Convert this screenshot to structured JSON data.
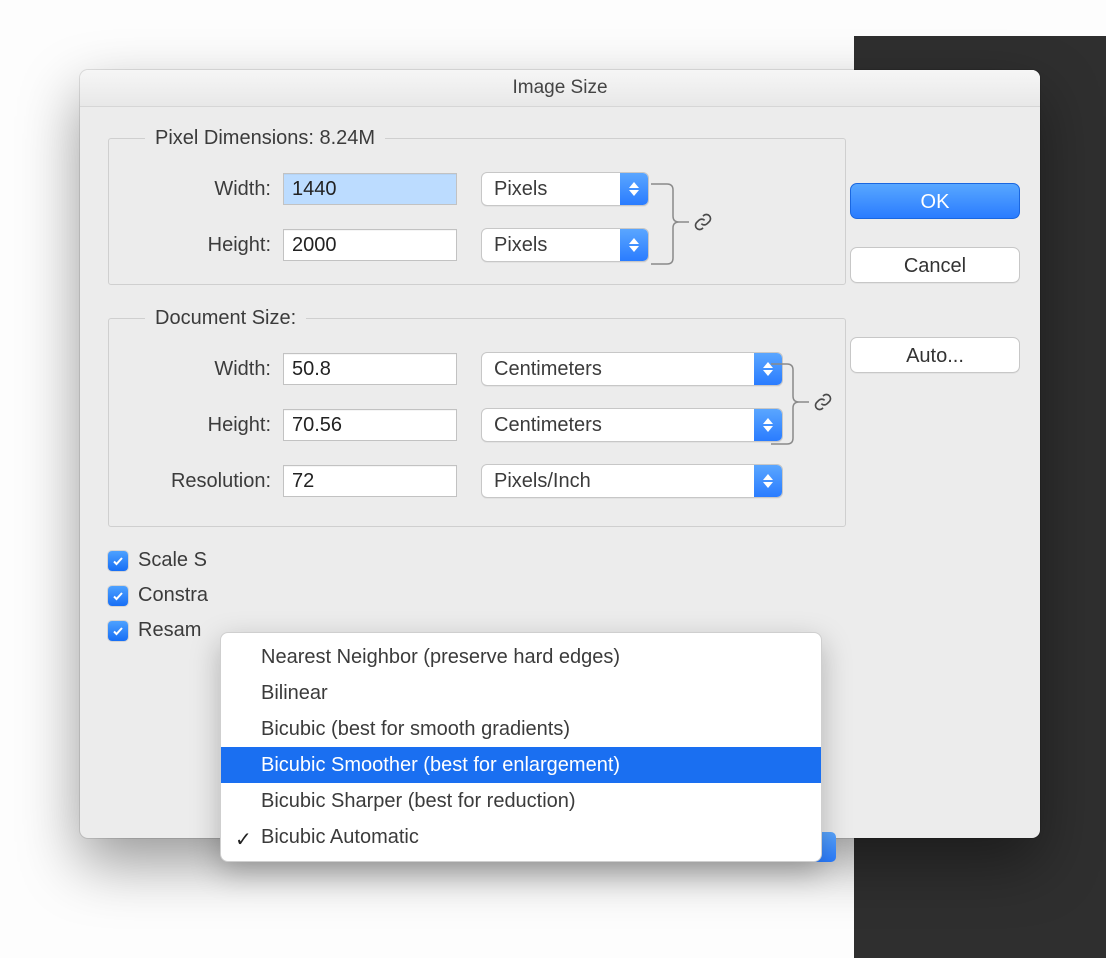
{
  "dialog_title": "Image Size",
  "pixel_dimensions": {
    "legend": "Pixel Dimensions:  8.24M",
    "width_label": "Width:",
    "width_value": "1440",
    "width_unit": "Pixels",
    "height_label": "Height:",
    "height_value": "2000",
    "height_unit": "Pixels"
  },
  "document_size": {
    "legend": "Document Size:",
    "width_label": "Width:",
    "width_value": "50.8",
    "width_unit": "Centimeters",
    "height_label": "Height:",
    "height_value": "70.56",
    "height_unit": "Centimeters",
    "resolution_label": "Resolution:",
    "resolution_value": "72",
    "resolution_unit": "Pixels/Inch"
  },
  "checkboxes": {
    "scale": {
      "label_visible": "Scale S",
      "checked": true
    },
    "constrain": {
      "label_visible": "Constra",
      "checked": true
    },
    "resample": {
      "label_visible": "Resam",
      "checked": true
    }
  },
  "dropdown": {
    "items": [
      "Nearest Neighbor (preserve hard edges)",
      "Bilinear",
      "Bicubic (best for smooth gradients)",
      "Bicubic Smoother (best for enlargement)",
      "Bicubic Sharper (best for reduction)",
      "Bicubic Automatic"
    ],
    "highlighted_index": 3,
    "checked_index": 5
  },
  "buttons": {
    "ok": "OK",
    "cancel": "Cancel",
    "auto": "Auto..."
  }
}
